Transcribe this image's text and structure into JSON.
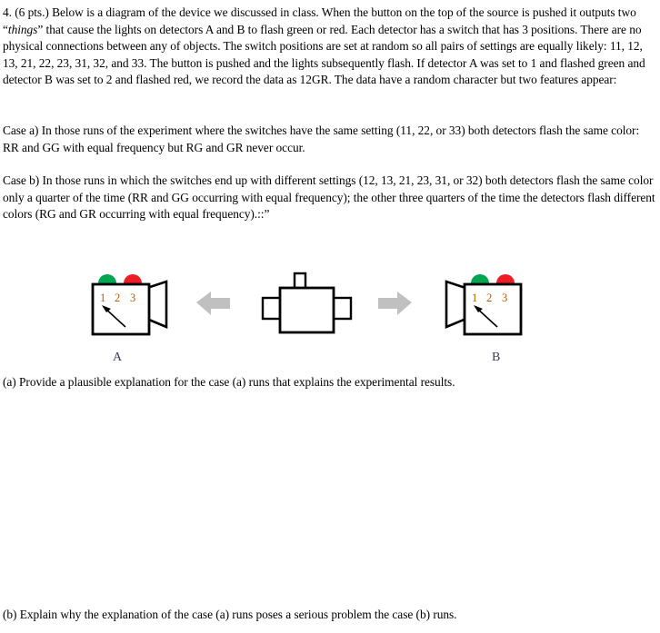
{
  "document": {
    "problem_number": "4.",
    "points": "(6 pts.)",
    "intro_paragraph": {
      "part1": "4. (6 pts.)  Below is a diagram of the device we discussed in class. When the button on the top of the source is pushed it outputs two “",
      "italic_word": "things",
      "part2": "” that cause the lights on detectors A and B to flash green or red. Each detector has a switch that has 3 positions. There are no physical connections between any of objects. The switch positions are set at random so all pairs of settings are equally likely: 11, 12, 13, 21, 22, 23, 31, 32, and 33. The button is pushed and the lights subsequently flash. If detector A was set to 1 and flashed green and detector B was set to 2 and flashed red, we record the data as 12GR.  The data have a random character but two features appear:"
    },
    "case_a_paragraph": "Case a) In those runs of the experiment where the switches have the same setting (11, 22, or 33) both detectors flash the same color: RR and GG with equal frequency but RG and GR never occur.",
    "case_b_paragraph": "Case b) In those runs in which the switches end up with different settings (12, 13, 21, 23, 31, or 32) both detectors flash the same color only a quarter of the time (RR and GG occurring with equal frequency); the other three quarters of the time the detectors flash different colors (RG and GR occurring with equal frequency).::”",
    "question_a": "(a) Provide a plausible explanation for the case (a) runs that explains the experimental results.",
    "question_b": "(b) Explain why the explanation of the case (a) runs poses a serious problem the case (b) runs."
  },
  "diagram": {
    "detector_a": {
      "label": "A",
      "switch_positions": [
        "1",
        "2",
        "3"
      ],
      "selected_position": "1",
      "lights": [
        {
          "name": "green-light",
          "color": "#00a550"
        },
        {
          "name": "red-light",
          "color": "#ee1c25"
        }
      ]
    },
    "detector_b": {
      "label": "B",
      "switch_positions": [
        "1",
        "2",
        "3"
      ],
      "selected_position": "1",
      "lights": [
        {
          "name": "green-light",
          "color": "#00a550"
        },
        {
          "name": "red-light",
          "color": "#ee1c25"
        }
      ]
    },
    "source": {
      "has_button": true
    },
    "arrows": {
      "left_arrow_color": "#c0c0c0",
      "right_arrow_color": "#c0c0c0"
    },
    "switch_number_color": "#b85c00",
    "outline_color": "#000000"
  }
}
